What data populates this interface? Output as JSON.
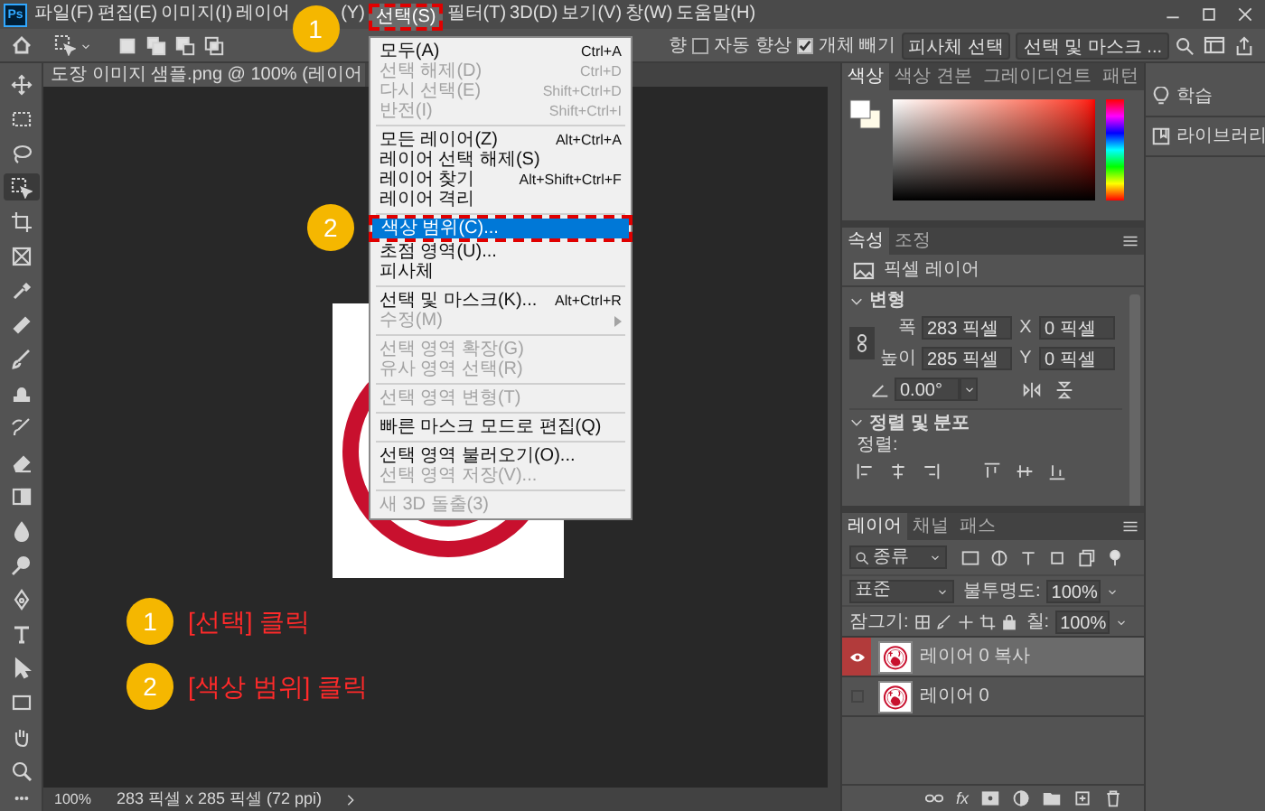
{
  "app": {
    "logo": "Ps"
  },
  "menu_bar": {
    "items": [
      {
        "kind": "menu",
        "label": "파일(F)",
        "selected": false
      },
      {
        "kind": "menu",
        "label": "편집(E)",
        "selected": false
      },
      {
        "kind": "menu",
        "label": "이미지(I)",
        "selected": false
      },
      {
        "kind": "menu",
        "label": "레이어",
        "selected": false
      },
      {
        "kind": "marker",
        "number": "1"
      },
      {
        "kind": "menu",
        "label": "(Y)",
        "selected": false
      },
      {
        "kind": "menu",
        "label": "선택(S)",
        "selected": true,
        "framed": true
      },
      {
        "kind": "menu",
        "label": "필터(T)",
        "selected": false
      },
      {
        "kind": "menu",
        "label": "3D(D)",
        "selected": false
      },
      {
        "kind": "menu",
        "label": "보기(V)",
        "selected": false
      },
      {
        "kind": "menu",
        "label": "창(W)",
        "selected": false
      },
      {
        "kind": "menu",
        "label": "도움말(H)",
        "selected": false
      }
    ]
  },
  "dropdown_menu": {
    "items": [
      {
        "kind": "item",
        "label": "모두(A)",
        "shortcut": "Ctrl+A",
        "disabled": false,
        "selected": false
      },
      {
        "kind": "item",
        "label": "선택 해제(D)",
        "shortcut": "Ctrl+D",
        "disabled": true,
        "selected": false
      },
      {
        "kind": "item",
        "label": "다시 선택(E)",
        "shortcut": "Shift+Ctrl+D",
        "disabled": true,
        "selected": false
      },
      {
        "kind": "item",
        "label": "반전(I)",
        "shortcut": "Shift+Ctrl+I",
        "disabled": true,
        "selected": false
      },
      {
        "kind": "separator"
      },
      {
        "kind": "item",
        "label": "모든 레이어(Z)",
        "shortcut": "Alt+Ctrl+A",
        "disabled": false,
        "selected": false
      },
      {
        "kind": "item",
        "label": "레이어 선택 해제(S)",
        "disabled": false,
        "selected": false
      },
      {
        "kind": "item",
        "label": "레이어 찾기",
        "shortcut": "Alt+Shift+Ctrl+F",
        "disabled": false,
        "selected": false
      },
      {
        "kind": "item",
        "label": "레이어 격리",
        "disabled": false,
        "selected": false
      },
      {
        "kind": "separator"
      },
      {
        "kind": "item",
        "label": "색상 범위(C)...",
        "disabled": false,
        "selected": true,
        "framed": true,
        "marker": "2"
      },
      {
        "kind": "item",
        "label": "초점 영역(U)...",
        "disabled": false,
        "selected": false
      },
      {
        "kind": "item",
        "label": "피사체",
        "disabled": false,
        "selected": false
      },
      {
        "kind": "separator"
      },
      {
        "kind": "item",
        "label": "선택 및 마스크(K)...",
        "shortcut": "Alt+Ctrl+R",
        "disabled": false,
        "selected": false
      },
      {
        "kind": "item",
        "label": "수정(M)",
        "disabled": true,
        "selected": false,
        "submenu": true
      },
      {
        "kind": "separator"
      },
      {
        "kind": "item",
        "label": "선택 영역 확장(G)",
        "disabled": true,
        "selected": false
      },
      {
        "kind": "item",
        "label": "유사 영역 선택(R)",
        "disabled": true,
        "selected": false
      },
      {
        "kind": "separator"
      },
      {
        "kind": "item",
        "label": "선택 영역 변형(T)",
        "disabled": true,
        "selected": false
      },
      {
        "kind": "separator"
      },
      {
        "kind": "item",
        "label": "빠른 마스크 모드로 편집(Q)",
        "disabled": false,
        "selected": false
      },
      {
        "kind": "separator"
      },
      {
        "kind": "item",
        "label": "선택 영역 불러오기(O)...",
        "disabled": false,
        "selected": false
      },
      {
        "kind": "item",
        "label": "선택 영역 저장(V)...",
        "disabled": true,
        "selected": false
      },
      {
        "kind": "separator"
      },
      {
        "kind": "item",
        "label": "새 3D 돌출(3)",
        "disabled": true,
        "selected": false
      }
    ]
  },
  "options_bar": {
    "fragment": "향",
    "checkboxes": [
      {
        "label": "자동 향상",
        "checked": false
      },
      {
        "label": "개체 빼기",
        "checked": true
      }
    ],
    "buttons": [
      "피사체 선택",
      "선택 및 마스크 ..."
    ]
  },
  "document": {
    "tab_title": "도장 이미지 샘플.png @ 100% (레이어"
  },
  "tools": [
    {
      "selected": false
    },
    {
      "selected": false
    },
    {
      "selected": false
    },
    {
      "selected": true
    },
    {
      "selected": false
    },
    {
      "selected": false
    },
    {
      "selected": false
    },
    {
      "selected": false
    },
    {
      "selected": false
    },
    {
      "selected": false
    },
    {
      "selected": false
    },
    {
      "selected": false
    },
    {
      "selected": false
    },
    {
      "selected": false
    },
    {
      "selected": false
    },
    {
      "selected": false
    },
    {
      "selected": false
    },
    {
      "selected": false
    },
    {
      "selected": false
    },
    {
      "selected": false
    },
    {
      "selected": false
    }
  ],
  "annotations": [
    {
      "number": "1",
      "text": "[선택] 클릭"
    },
    {
      "number": "2",
      "text": "[색상 범위] 클릭"
    }
  ],
  "status_bar": {
    "zoom": "100%",
    "info": "283 픽셀 x 285 픽셀 (72 ppi)"
  },
  "color_panel": {
    "tabs": [
      {
        "label": "색상",
        "selected": true
      },
      {
        "label": "색상 견본",
        "selected": false
      },
      {
        "label": "그레이디언트",
        "selected": false
      },
      {
        "label": "패턴",
        "selected": false
      }
    ]
  },
  "properties_panel": {
    "tabs": [
      {
        "label": "속성",
        "selected": true
      },
      {
        "label": "조정",
        "selected": false
      }
    ],
    "layer_type": "픽셀 레이어",
    "transform": {
      "title": "변형",
      "expanded": true,
      "width_label": "폭",
      "width": "283 픽셀",
      "x_label": "X",
      "x": "0 픽셀",
      "height_label": "높이",
      "height": "285 픽셀",
      "y_label": "Y",
      "y": "0 픽셀",
      "angle": "0.00°"
    },
    "align": {
      "title": "정렬 및 분포",
      "expanded": true,
      "label": "정렬:"
    }
  },
  "layers_panel": {
    "tabs": [
      {
        "label": "레이어",
        "selected": true
      },
      {
        "label": "채널",
        "selected": false
      },
      {
        "label": "패스",
        "selected": false
      }
    ],
    "filter": "종류",
    "blend_mode": "표준",
    "opacity_label": "불투명도:",
    "opacity": "100%",
    "lock_label": "잠그기:",
    "fill_label": "칠:",
    "fill": "100%",
    "effects_button": "fx",
    "layers": [
      {
        "name": "레이어 0 복사",
        "visible": true,
        "selected": true
      },
      {
        "name": "레이어 0",
        "visible": false,
        "selected": false
      }
    ]
  },
  "side_panels": [
    {
      "kind": "learn",
      "label": "학습"
    },
    {
      "kind": "library",
      "label": "라이브러리"
    }
  ]
}
